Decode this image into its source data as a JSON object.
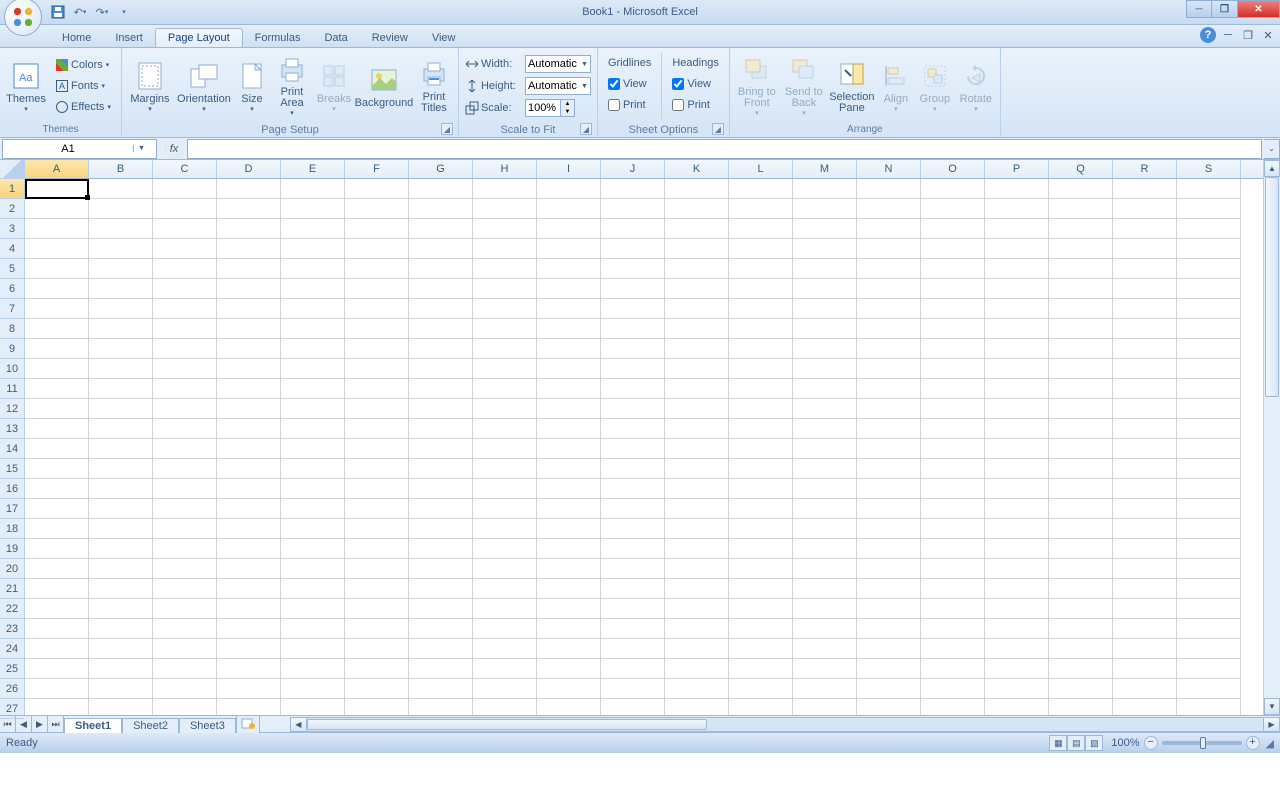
{
  "title": "Book1 - Microsoft Excel",
  "tabs": [
    "Home",
    "Insert",
    "Page Layout",
    "Formulas",
    "Data",
    "Review",
    "View"
  ],
  "active_tab": 2,
  "themes": {
    "label": "Themes",
    "colors": "Colors",
    "fonts": "Fonts",
    "effects": "Effects",
    "group": "Themes"
  },
  "pagesetup": {
    "margins": "Margins",
    "orientation": "Orientation",
    "size": "Size",
    "printarea": "Print Area",
    "breaks": "Breaks",
    "background": "Background",
    "printtitles": "Print Titles",
    "group": "Page Setup"
  },
  "scale": {
    "width": "Width:",
    "height": "Height:",
    "scale": "Scale:",
    "auto": "Automatic",
    "pct": "100%",
    "group": "Scale to Fit"
  },
  "sheetopt": {
    "gridlines": "Gridlines",
    "headings": "Headings",
    "view": "View",
    "print": "Print",
    "group": "Sheet Options"
  },
  "arrange": {
    "bring": "Bring to Front",
    "send": "Send to Back",
    "selpane": "Selection Pane",
    "align": "Align",
    "group_btn": "Group",
    "rotate": "Rotate",
    "group": "Arrange"
  },
  "cellref": "A1",
  "columns": [
    "A",
    "B",
    "C",
    "D",
    "E",
    "F",
    "G",
    "H",
    "I",
    "J",
    "K",
    "L",
    "M",
    "N",
    "O",
    "P",
    "Q",
    "R",
    "S"
  ],
  "rows": 27,
  "sheets": [
    "Sheet1",
    "Sheet2",
    "Sheet3"
  ],
  "active_sheet": 0,
  "status": "Ready",
  "zoom": "100%"
}
